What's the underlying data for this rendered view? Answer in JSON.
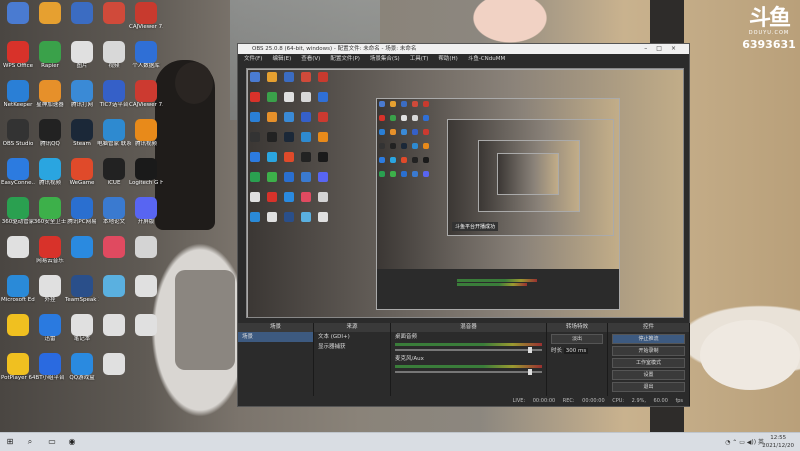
{
  "overlay": {
    "logo_text": "斗鱼",
    "logo_site": "DOUYU.COM",
    "room_id": "6393631"
  },
  "desktop_icons": [
    {
      "label": "",
      "color": "#4a7bd1"
    },
    {
      "label": "",
      "color": "#e6a030"
    },
    {
      "label": "",
      "color": "#3b6cc2"
    },
    {
      "label": "",
      "color": "#d04a3a"
    },
    {
      "label": "CAJViewer 7.2",
      "color": "#c83a2e"
    },
    {
      "label": "WPS Office",
      "color": "#d8322a"
    },
    {
      "label": "Rapier",
      "color": "#3aa14a"
    },
    {
      "label": "图片",
      "color": "#e0e0e0"
    },
    {
      "label": "视频",
      "color": "#d8d8d8"
    },
    {
      "label": "个人数据库",
      "color": "#2f6fd6"
    },
    {
      "label": "NetKeeper",
      "color": "#2a7fd6"
    },
    {
      "label": "星神加速器",
      "color": "#e6902a"
    },
    {
      "label": "腾讯打网",
      "color": "#3a8ad6"
    },
    {
      "label": "TIC7话平台",
      "color": "#3560c8"
    },
    {
      "label": "CAJViewer 7.2",
      "color": "#cc3a30"
    },
    {
      "label": "OBS Studio",
      "color": "#333333"
    },
    {
      "label": "腾讯QQ",
      "color": "#222222"
    },
    {
      "label": "Steam",
      "color": "#1b2838"
    },
    {
      "label": "电脑管家 联系",
      "color": "#2e8ad0"
    },
    {
      "label": "腾讯视频",
      "color": "#e88a1a"
    },
    {
      "label": "EasyConne...",
      "color": "#2c7be0"
    },
    {
      "label": "腾讯视频",
      "color": "#2aa5e0"
    },
    {
      "label": "WeGame",
      "color": "#e04a2a"
    },
    {
      "label": "iCUE",
      "color": "#222222"
    },
    {
      "label": "Logitech G HUB",
      "color": "#1a1a1a"
    },
    {
      "label": "360驱动管家",
      "color": "#2aa050"
    },
    {
      "label": "360安全卫士",
      "color": "#3db04a"
    },
    {
      "label": "腾讯PC网易",
      "color": "#2a6fd0"
    },
    {
      "label": "本地论文",
      "color": "#3a7ad0"
    },
    {
      "label": "开屏版",
      "color": "#5865f2"
    },
    {
      "label": "",
      "color": "#e0e0e0"
    },
    {
      "label": "网易云音乐",
      "color": "#d8322a"
    },
    {
      "label": "",
      "color": "#2a8ae0"
    },
    {
      "label": "",
      "color": "#e04a60"
    },
    {
      "label": "",
      "color": "#d4d4d4"
    },
    {
      "label": "Microsoft Edge",
      "color": "#2a8ad8"
    },
    {
      "label": "外挂",
      "color": "#e0e0e0"
    },
    {
      "label": "TeamSpeak 3",
      "color": "#2a4f8a"
    },
    {
      "label": "",
      "color": "#5ab0e0"
    },
    {
      "label": "",
      "color": "#e0e0e0"
    },
    {
      "label": "",
      "color": "#f0c020"
    },
    {
      "label": "迅雷",
      "color": "#2a7ae0"
    },
    {
      "label": "笔记本",
      "color": "#e0e0e0"
    },
    {
      "label": "",
      "color": "#e0e0e0"
    },
    {
      "label": "",
      "color": "#e0e0e0"
    },
    {
      "label": "PotPlayer 64 bit",
      "color": "#f0c020"
    },
    {
      "label": "BT小组平台",
      "color": "#2a6ae0"
    },
    {
      "label": "QQ游戏盒",
      "color": "#2a8ae0"
    },
    {
      "label": "",
      "color": "#e0e0e0"
    }
  ],
  "obs": {
    "title": "OBS 25.0.8 (64-bit, windows) - 配置文件: 未命名 - 场景: 未命名",
    "menu": [
      "文件(F)",
      "编辑(E)",
      "查看(V)",
      "配置文件(P)",
      "场景集合(S)",
      "工具(T)",
      "帮助(H)",
      "斗鱼-CNduMM"
    ],
    "docks": {
      "scenes": {
        "header": "场景",
        "items": [
          "场景"
        ]
      },
      "sources": {
        "header": "来源",
        "items": [
          "文本 (GDI+)",
          "显示器捕获"
        ]
      },
      "mixer": {
        "header": "混音器",
        "tracks": [
          "桌面音频",
          "麦克风/Aux"
        ]
      },
      "transitions": {
        "header": "转场特效",
        "type": "淡出",
        "duration_label": "时长",
        "duration": "300 ms"
      },
      "controls": {
        "header": "控件",
        "buttons": [
          "停止推流",
          "开始录制",
          "工作室模式",
          "设置",
          "退出"
        ]
      }
    },
    "nested_notice": "斗鱼平台开播成功",
    "status": [
      "LIVE: 00:00:00",
      "REC: 00:00:00",
      "CPU: 2.9%, 60.00 fps"
    ]
  },
  "taskbar": {
    "items": [
      "start-icon",
      "search-icon",
      "task-view-icon",
      "obs-icon"
    ],
    "tray_text": "英",
    "time": "12:55",
    "date": "2021/12/20"
  }
}
